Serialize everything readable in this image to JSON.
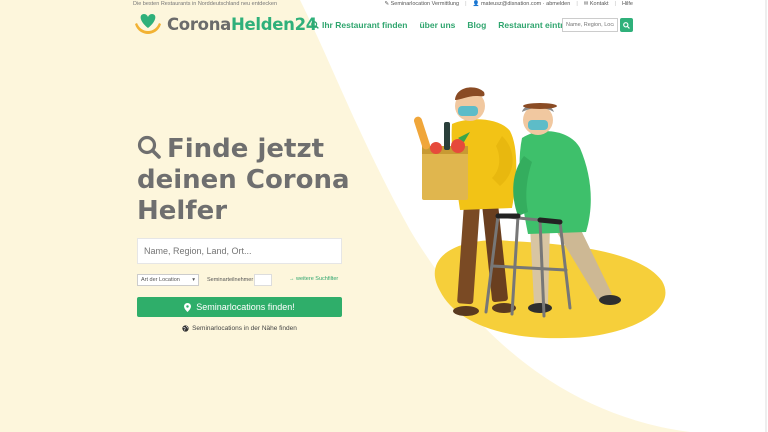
{
  "topbar": {
    "tagline": "Die besten Restaurants in Norddeutschland neu entdecken",
    "links": [
      {
        "label": "Seminarlocation Vermittlung",
        "icon": "pencil-icon"
      },
      {
        "label": "mateusz@disnation.com · abmelden",
        "icon": "user-icon"
      },
      {
        "label": "Kontakt",
        "icon": "envelope-icon"
      },
      {
        "label": "Hilfe",
        "icon": ""
      }
    ]
  },
  "header": {
    "logo_part1": "Corona",
    "logo_part2": "Helden24",
    "nav": [
      {
        "label": "Ihr Restaurant finden",
        "icon": "search-icon"
      },
      {
        "label": "über uns"
      },
      {
        "label": "Blog"
      },
      {
        "label": "Restaurant eintragen"
      }
    ],
    "search_placeholder": "Name, Region, Loca"
  },
  "hero": {
    "title_line1": "Finde jetzt",
    "title_line2": "deinen Corona",
    "title_line3": "Helfer",
    "input_placeholder": "Name, Region, Land, Ort...",
    "location_select": "Art der Location",
    "participants_label": "Seminarteilnehmer",
    "more_filters": "→ weitere Suchfilter",
    "cta_label": "Seminarlocations finden!",
    "nearby_label": "Seminarlocations in der Nähe finden"
  },
  "colors": {
    "brand_green": "#2fae6a",
    "logo_grey": "#6b6b6b",
    "wash_yellow": "#fdf6dc"
  }
}
